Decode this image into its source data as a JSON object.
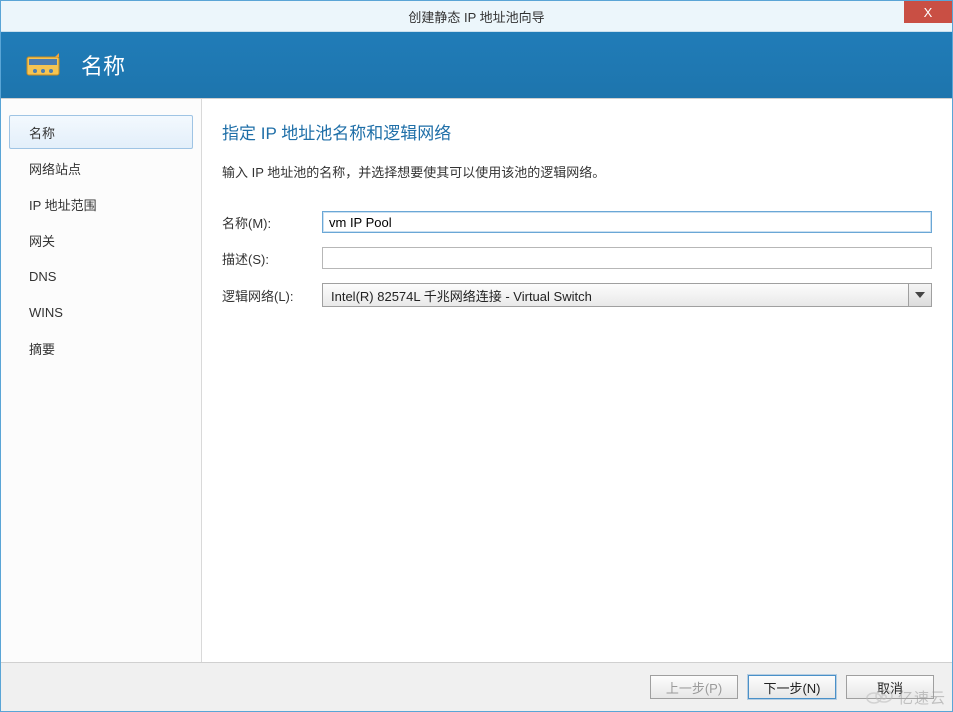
{
  "window": {
    "title": "创建静态 IP 地址池向导",
    "close_label": "X"
  },
  "banner": {
    "title": "名称"
  },
  "sidebar": {
    "items": [
      {
        "label": "名称",
        "selected": true
      },
      {
        "label": "网络站点",
        "selected": false
      },
      {
        "label": "IP 地址范围",
        "selected": false
      },
      {
        "label": "网关",
        "selected": false
      },
      {
        "label": "DNS",
        "selected": false
      },
      {
        "label": "WINS",
        "selected": false
      },
      {
        "label": "摘要",
        "selected": false
      }
    ]
  },
  "main": {
    "section_title": "指定 IP 地址池名称和逻辑网络",
    "section_desc": "输入 IP 地址池的名称，并选择想要使其可以使用该池的逻辑网络。",
    "fields": {
      "name": {
        "label": "名称(M):",
        "value": "vm IP Pool"
      },
      "desc": {
        "label": "描述(S):",
        "value": ""
      },
      "logical": {
        "label": "逻辑网络(L):",
        "value": "Intel(R) 82574L 千兆网络连接 - Virtual Switch"
      }
    }
  },
  "footer": {
    "prev": "上一步(P)",
    "next": "下一步(N)",
    "cancel": "取消"
  },
  "watermark": {
    "text": "亿速云"
  }
}
